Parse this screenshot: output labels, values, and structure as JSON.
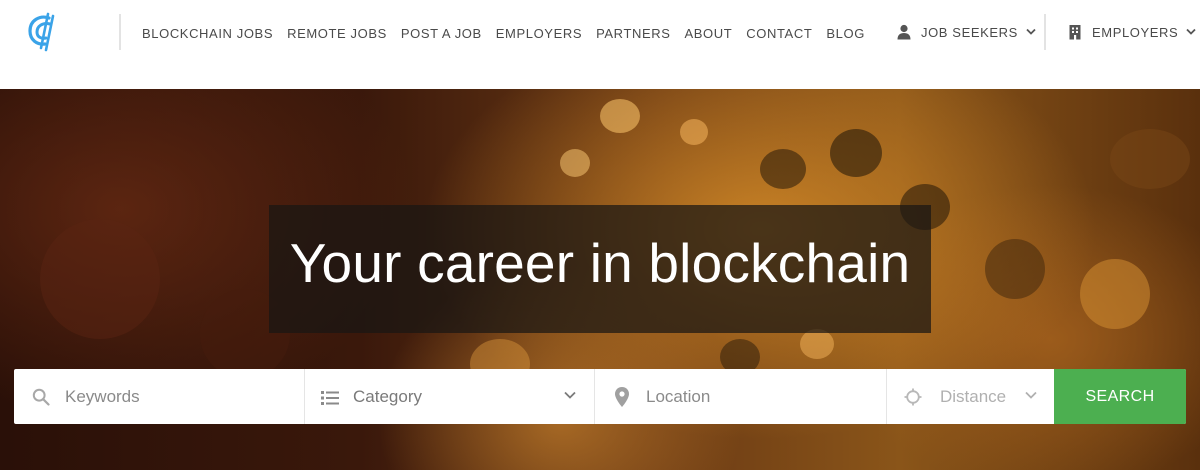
{
  "brand": {
    "accent": "#3aa3e8",
    "logo_icon": "crypto-c-logo-icon"
  },
  "nav": {
    "items": [
      {
        "label": "BLOCKCHAIN JOBS"
      },
      {
        "label": "REMOTE JOBS"
      },
      {
        "label": "POST A JOB"
      },
      {
        "label": "EMPLOYERS"
      },
      {
        "label": "PARTNERS"
      },
      {
        "label": "ABOUT"
      },
      {
        "label": "CONTACT"
      },
      {
        "label": "BLOG"
      }
    ],
    "job_seekers": {
      "label": "JOB SEEKERS",
      "icon": "user-icon"
    },
    "employers": {
      "label": "EMPLOYERS",
      "icon": "building-icon"
    }
  },
  "hero": {
    "title": "Your career in blockchain"
  },
  "search": {
    "keywords_placeholder": "Keywords",
    "category_label": "Category",
    "location_placeholder": "Location",
    "distance_label": "Distance",
    "button_label": "SEARCH",
    "button_color": "#4caf50"
  }
}
